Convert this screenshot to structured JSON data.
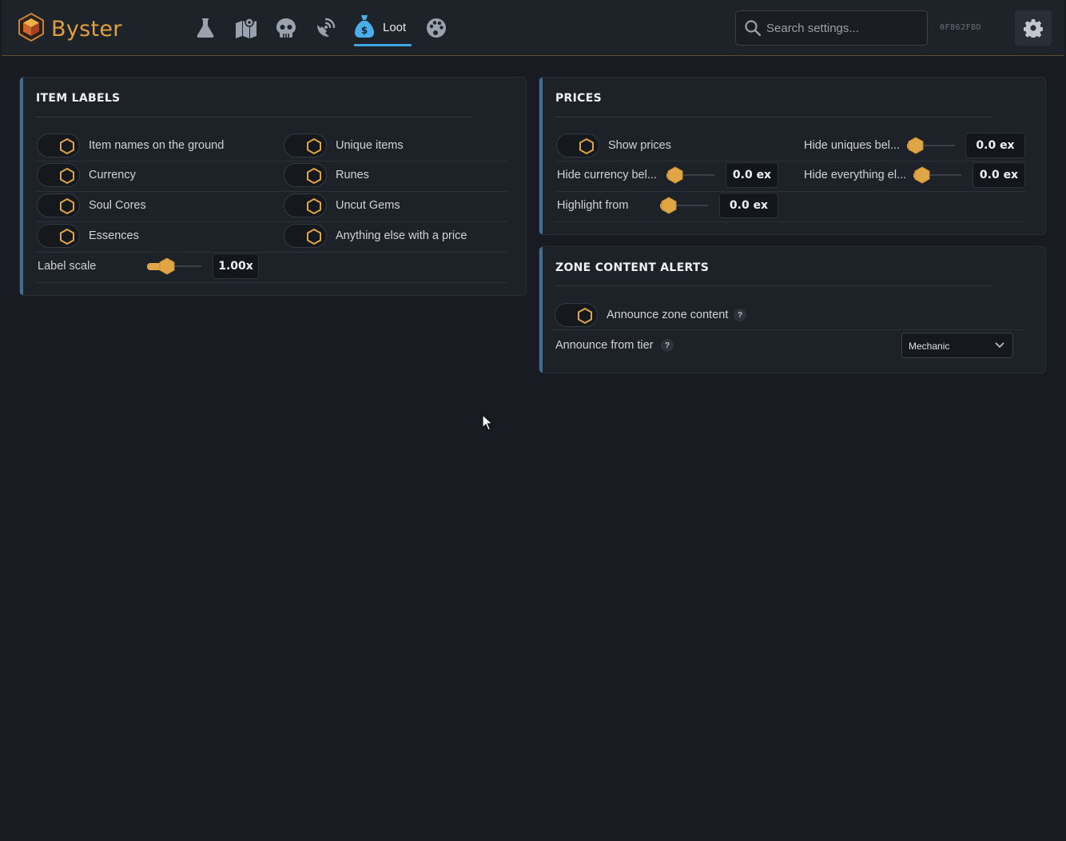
{
  "header": {
    "app_name": "Byster",
    "nav_icons": [
      "flask-icon",
      "map-icon",
      "skull-icon",
      "satellite-dish-icon",
      "money-bag-icon",
      "palette-icon"
    ],
    "active_tab": "Loot",
    "search_placeholder": "Search settings...",
    "session_id": "0F862FBD",
    "settings_icon": "gear-icon"
  },
  "colors": {
    "accent_gold": "#e0a646",
    "accent_blue": "#3fa6e6",
    "panel_stripe": "#3d6e96",
    "background": "#181c22"
  },
  "item_labels": {
    "title": "ITEM LABELS",
    "toggles": [
      {
        "label": "Item names on the ground",
        "on": false
      },
      {
        "label": "Unique items",
        "on": false
      },
      {
        "label": "Currency",
        "on": false
      },
      {
        "label": "Runes",
        "on": false
      },
      {
        "label": "Soul Cores",
        "on": false
      },
      {
        "label": "Uncut Gems",
        "on": false
      },
      {
        "label": "Essences",
        "on": false
      },
      {
        "label": "Anything else with a price",
        "on": false
      }
    ],
    "label_scale": {
      "label": "Label scale",
      "value": "1.00x",
      "level": 0.3
    }
  },
  "prices": {
    "title": "PRICES",
    "show_prices": {
      "label": "Show prices",
      "on": false
    },
    "hide_uniques": {
      "label": "Hide uniques bel...",
      "value": "0.0 ex",
      "level": 0
    },
    "hide_currency": {
      "label": "Hide currency bel...",
      "value": "0.0 ex",
      "level": 0
    },
    "hide_everything": {
      "label": "Hide everything el...",
      "value": "0.0 ex",
      "level": 0
    },
    "highlight_from": {
      "label": "Highlight from",
      "value": "0.0 ex",
      "level": 0
    }
  },
  "zone_alerts": {
    "title": "ZONE CONTENT ALERTS",
    "announce": {
      "label": "Announce zone content",
      "help": "?",
      "on": false
    },
    "tier": {
      "label": "Announce from tier",
      "help": "?",
      "value": "Mechanic"
    }
  }
}
